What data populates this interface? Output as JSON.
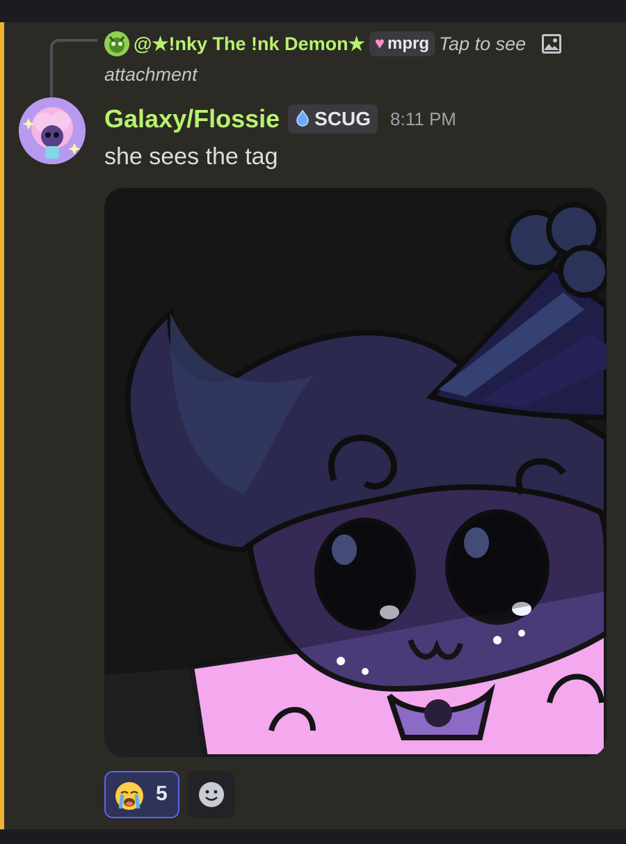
{
  "reply": {
    "author": "@★!nky The !nk Demon★",
    "tag_label": "mprg",
    "preview_text_line1": "Tap to see",
    "preview_text_line2": "attachment"
  },
  "message": {
    "author": "Galaxy/Flossie",
    "tag_label": "SCUG",
    "timestamp": "8:11 PM",
    "content": "she sees the tag"
  },
  "reactions": [
    {
      "emoji": "loudly-crying-face",
      "count": "5",
      "selected": true
    }
  ],
  "colors": {
    "mention_highlight": "#f0b232",
    "username_green": "#b7f26e",
    "reaction_border": "#5865f2"
  }
}
